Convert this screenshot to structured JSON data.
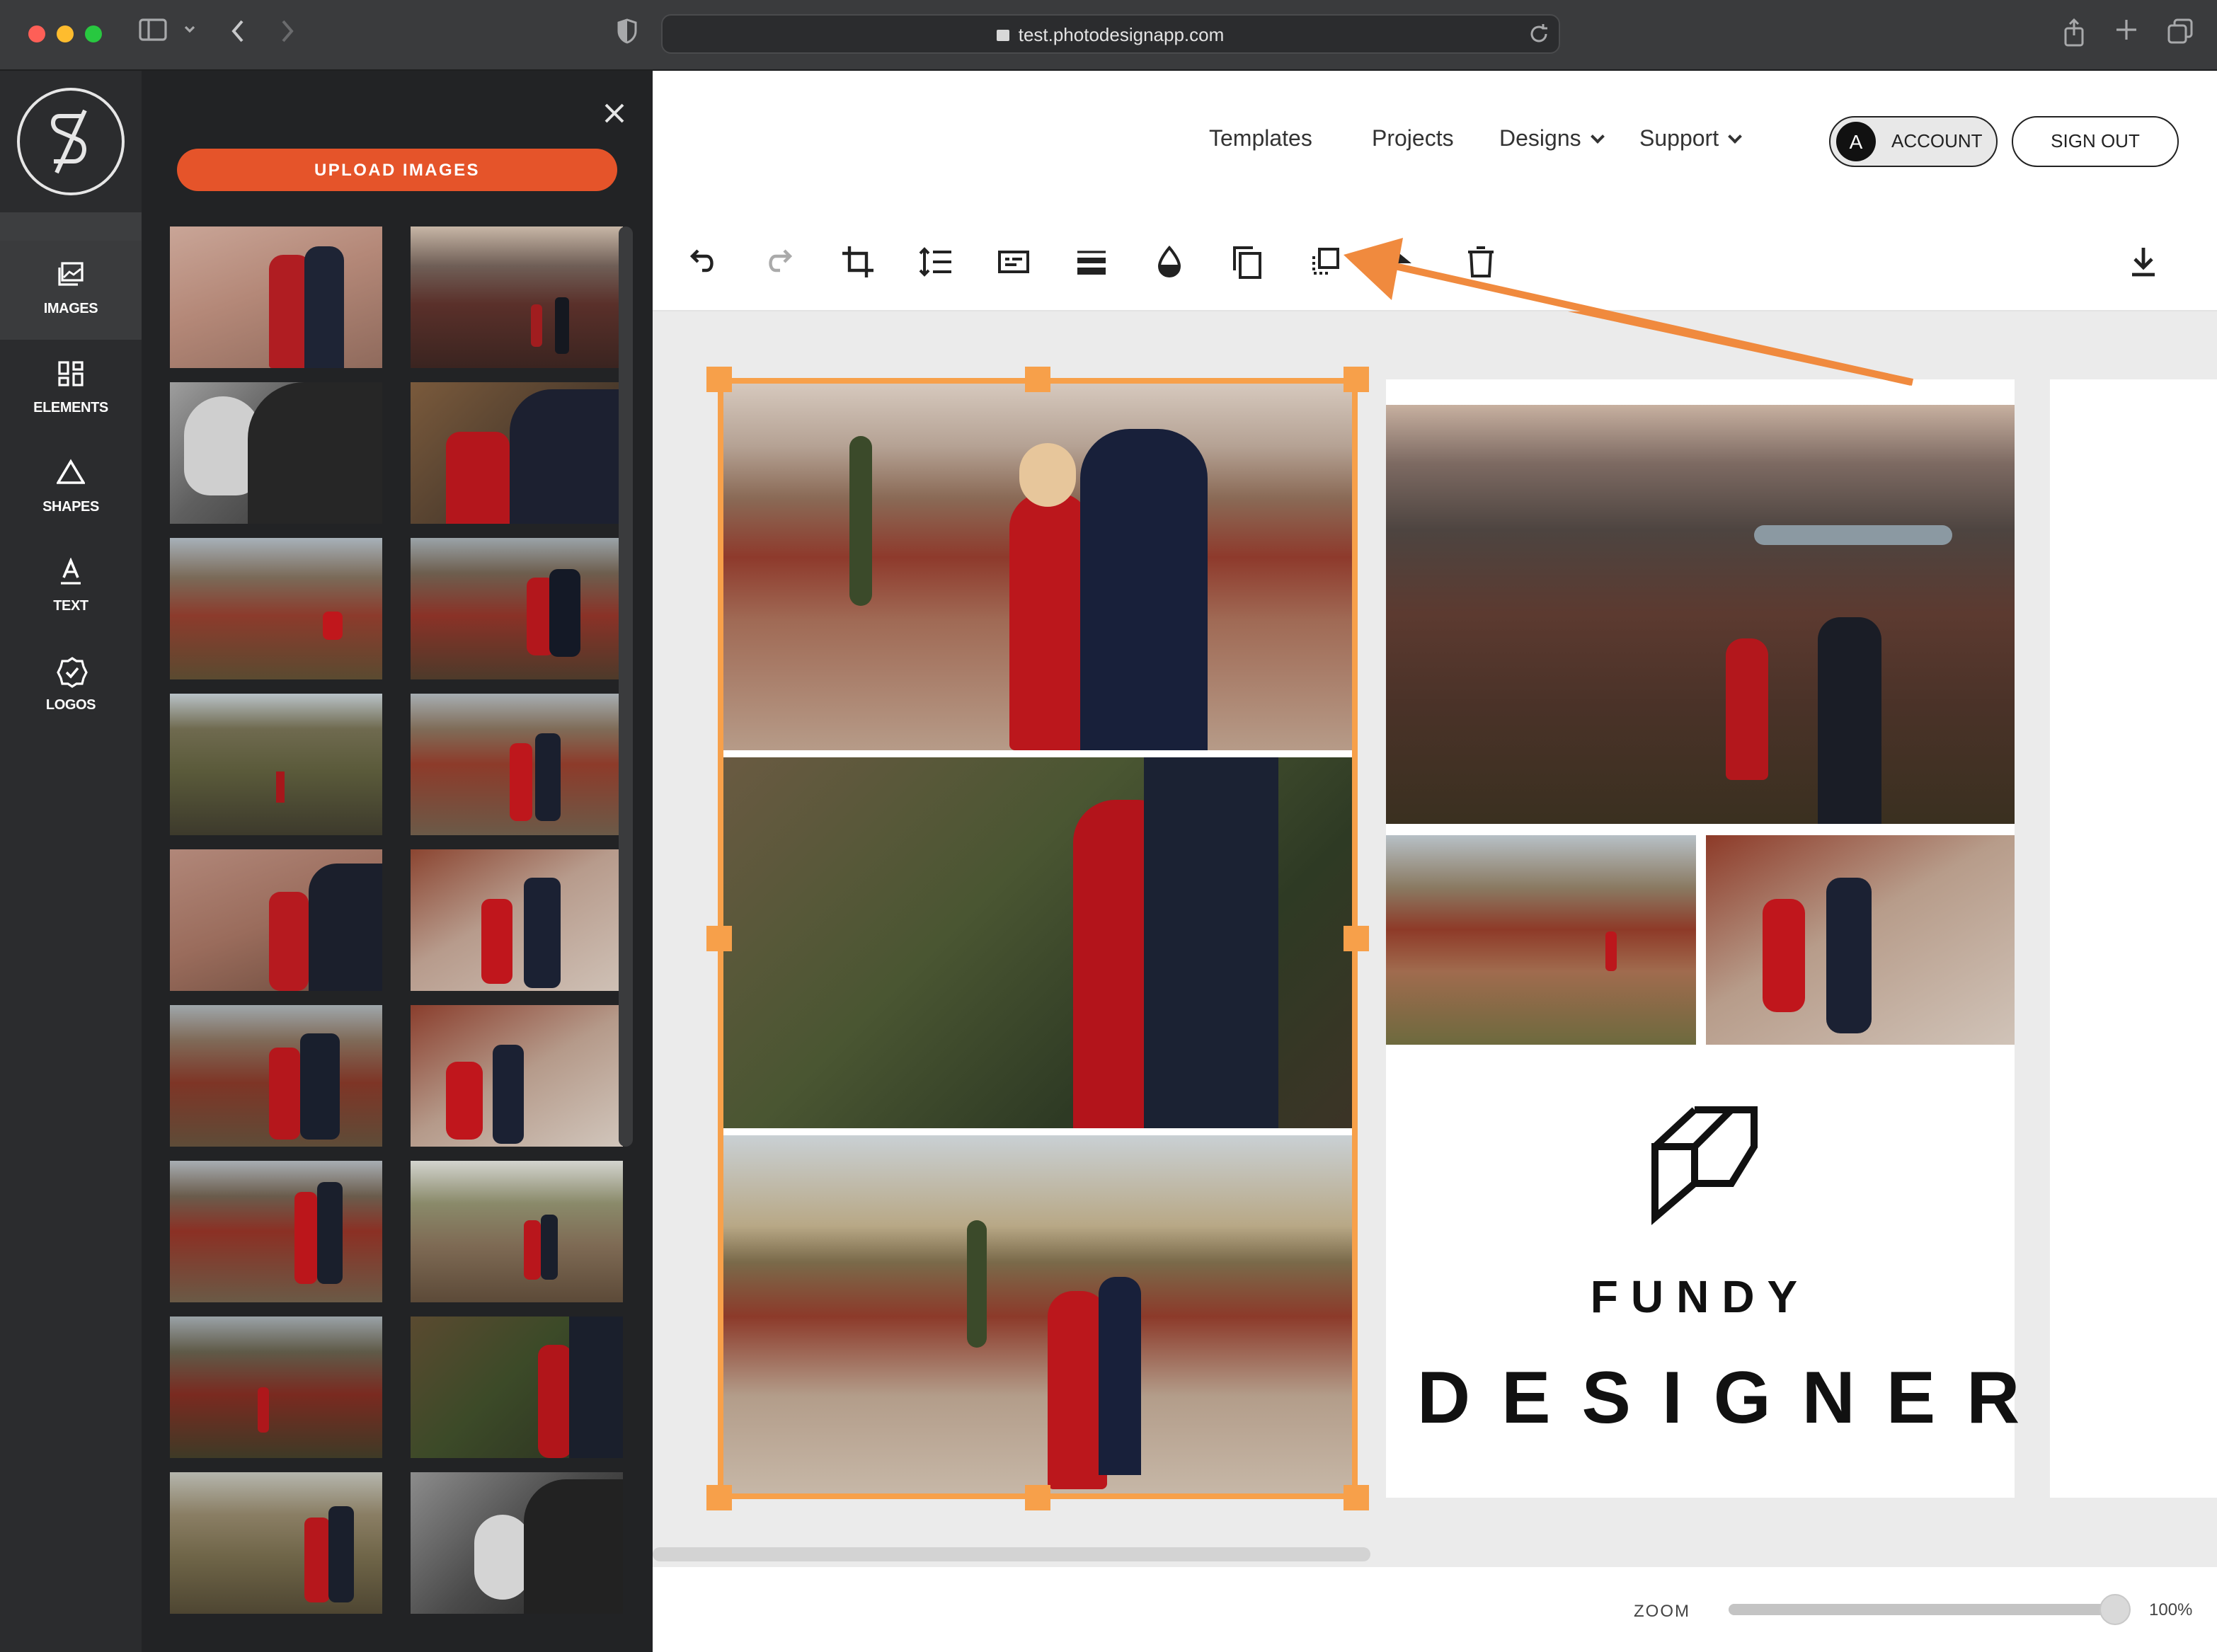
{
  "browser": {
    "url": "test.photodesignapp.com"
  },
  "sidebar": {
    "items": [
      {
        "label": "IMAGES",
        "icon": "images-icon"
      },
      {
        "label": "ELEMENTS",
        "icon": "elements-icon"
      },
      {
        "label": "SHAPES",
        "icon": "shapes-icon"
      },
      {
        "label": "TEXT",
        "icon": "text-icon"
      },
      {
        "label": "LOGOS",
        "icon": "logos-icon"
      }
    ]
  },
  "panel": {
    "upload_label": "UPLOAD IMAGES"
  },
  "nav": {
    "templates": "Templates",
    "projects": "Projects",
    "designs": "Designs",
    "support": "Support",
    "account_initial": "A",
    "account": "ACCOUNT",
    "signout": "SIGN OUT"
  },
  "toolbar": {
    "tools": [
      "undo-icon",
      "redo-icon",
      "crop-icon",
      "line-spacing-icon",
      "caption-icon",
      "layout-lines-icon",
      "fill-color-icon",
      "duplicate-icon",
      "arrange-icon",
      "flip-icon",
      "delete-icon",
      "download-icon"
    ]
  },
  "design": {
    "brand_line1": "FUNDY",
    "brand_line2": "DESIGNER"
  },
  "zoom": {
    "label": "ZOOM",
    "value": "100%",
    "level": 0.985
  },
  "colors": {
    "accent": "#e5542a",
    "selection": "#f7a04a",
    "annotation_arrow": "#f08a3e"
  }
}
